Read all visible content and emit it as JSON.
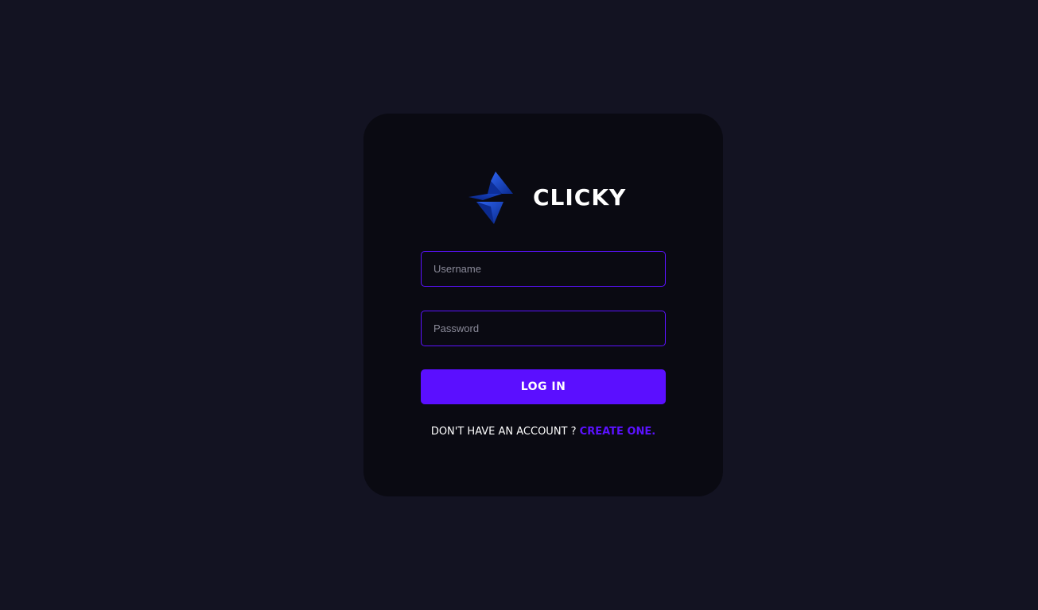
{
  "brand": {
    "name": "CLICKY",
    "icon": "clicky-logo-icon"
  },
  "form": {
    "username": {
      "placeholder": "Username",
      "value": ""
    },
    "password": {
      "placeholder": "Password",
      "value": ""
    },
    "login_label": "LOG IN"
  },
  "signup": {
    "prompt": "DON'T HAVE AN ACCOUNT ? ",
    "link_label": "CREATE ONE."
  },
  "colors": {
    "page_background": "#131322",
    "card_background": "#0a0a12",
    "accent": "#5b0fff",
    "logo_blue": "#1e4fd8",
    "text": "#ffffff"
  }
}
